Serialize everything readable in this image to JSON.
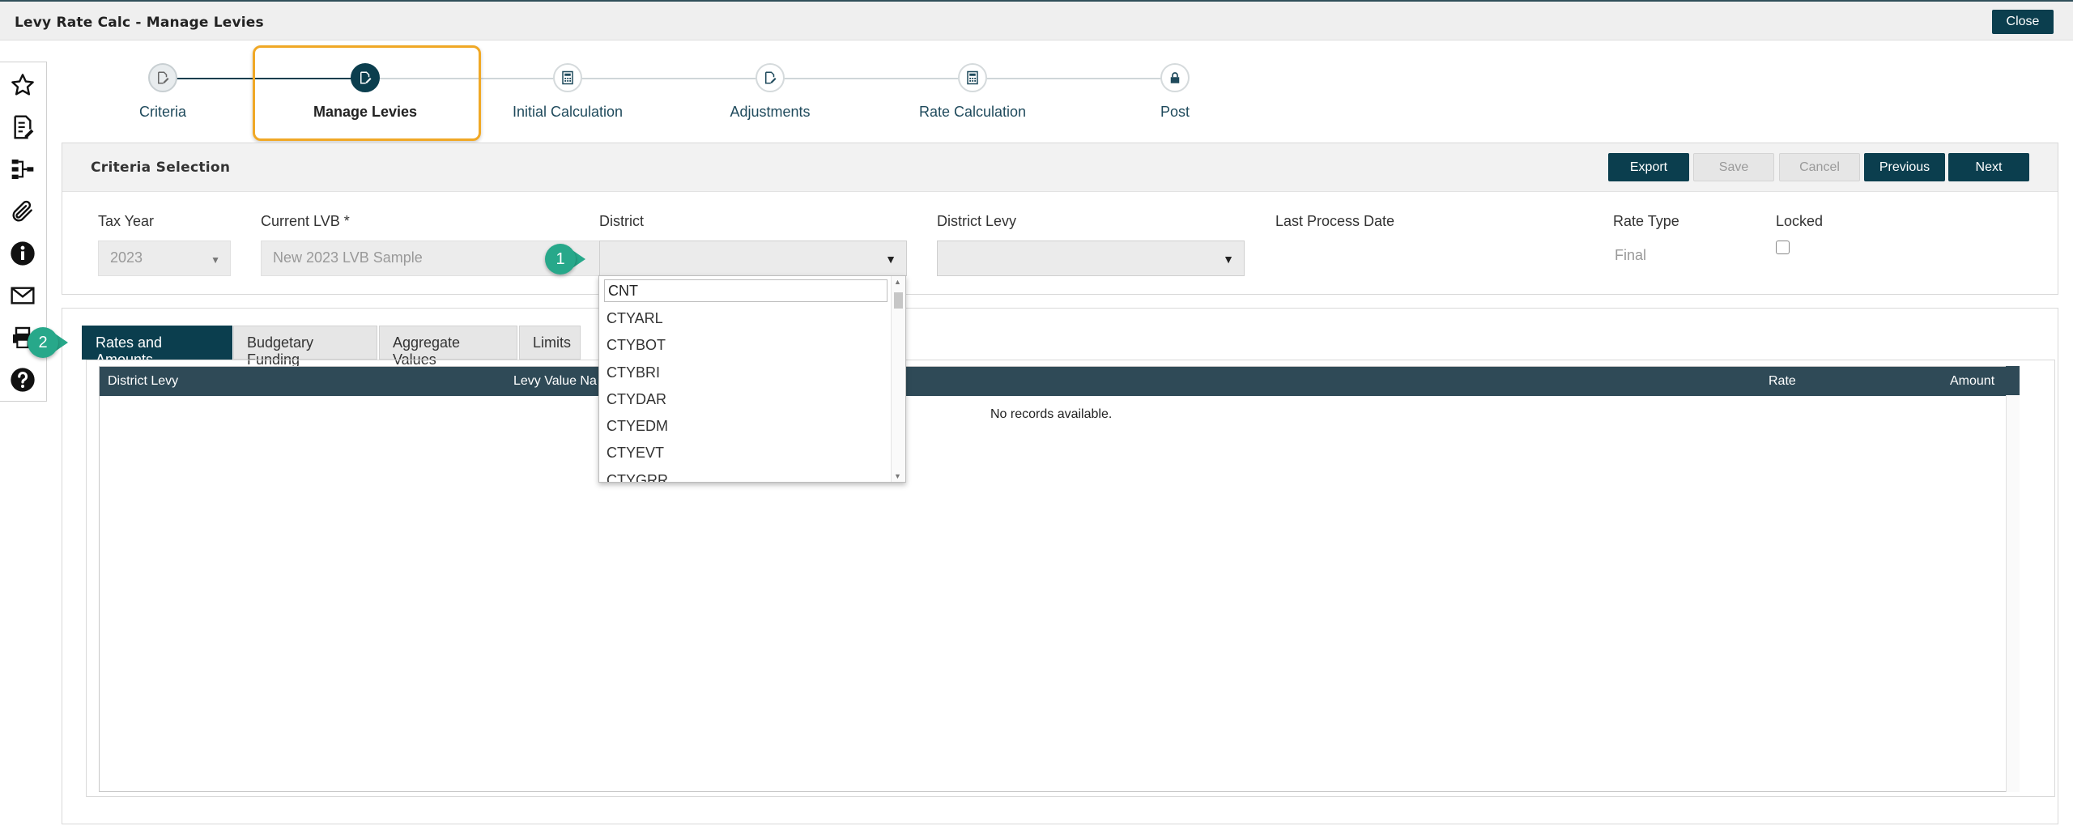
{
  "window": {
    "title": "Levy Rate Calc - Manage Levies",
    "close_label": "Close"
  },
  "sidebar": {
    "icons": [
      "star-icon",
      "edit-document-icon",
      "hierarchy-icon",
      "paperclip-icon",
      "info-icon",
      "mail-icon",
      "print-icon",
      "help-icon"
    ]
  },
  "stepper": {
    "steps": [
      {
        "label": "Criteria",
        "state": "done"
      },
      {
        "label": "Manage Levies",
        "state": "active"
      },
      {
        "label": "Initial Calculation",
        "state": "pending"
      },
      {
        "label": "Adjustments",
        "state": "pending"
      },
      {
        "label": "Rate Calculation",
        "state": "pending"
      },
      {
        "label": "Post",
        "state": "pending"
      }
    ]
  },
  "criteria": {
    "title": "Criteria Selection",
    "buttons": {
      "export": "Export",
      "save": "Save",
      "cancel": "Cancel",
      "previous": "Previous",
      "next": "Next"
    },
    "fields": {
      "tax_year": {
        "label": "Tax Year",
        "value": "2023"
      },
      "current_lvb": {
        "label": "Current LVB *",
        "value": "New 2023 LVB Sample"
      },
      "district": {
        "label": "District",
        "value": ""
      },
      "district_levy": {
        "label": "District Levy",
        "value": ""
      },
      "last_process_date": {
        "label": "Last Process Date",
        "value": ""
      },
      "rate_type": {
        "label": "Rate Type",
        "value": "Final"
      },
      "locked": {
        "label": "Locked",
        "checked": false
      }
    }
  },
  "district_dropdown": {
    "search_value": "CNT",
    "options": [
      "CTYARL",
      "CTYBOT",
      "CTYBRI",
      "CTYDAR",
      "CTYEDM",
      "CTYEVT",
      "CTYGRR"
    ]
  },
  "callouts": {
    "one": "1",
    "two": "2"
  },
  "tabs": [
    "Rates and Amounts",
    "Budgetary Funding",
    "Aggregate Values",
    "Limits"
  ],
  "grid": {
    "columns": [
      "District Levy",
      "Levy Value Na",
      "Rate",
      "Amount"
    ],
    "empty_message": "No records available."
  },
  "colors": {
    "primary": "#0b3e4e",
    "callout": "#27a88a",
    "highlight": "#f0a826",
    "grid_header": "#2f4a57"
  }
}
